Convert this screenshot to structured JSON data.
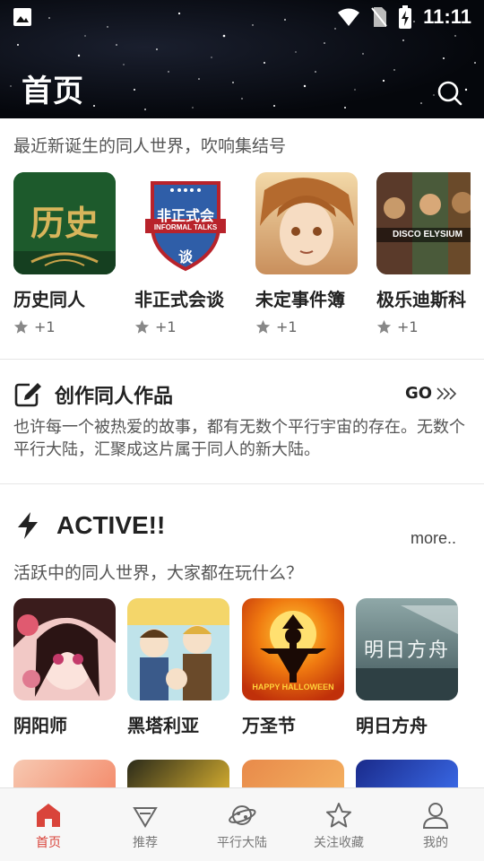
{
  "status_bar": {
    "time": "11:11",
    "icons": [
      "image-icon",
      "wifi-icon",
      "no-sim-icon",
      "battery-charging-icon"
    ]
  },
  "header": {
    "title": "首页",
    "search_icon": "search-icon"
  },
  "newborn": {
    "tagline": "最近新诞生的同人世界，吹响集结号",
    "worlds": [
      {
        "name": "历史同人",
        "count": "+1",
        "thumb_text": "历史"
      },
      {
        "name": "非正式会谈",
        "count": "+1",
        "thumb_text": "非正式会谈"
      },
      {
        "name": "未定事件簿",
        "count": "+1"
      },
      {
        "name": "极乐迪斯科",
        "count": "+1",
        "thumb_text": "DISCO ELYSIUM"
      }
    ]
  },
  "create": {
    "title": "创作同人作品",
    "go_label": "GO",
    "description": "也许每一个被热爱的故事，都有无数个平行宇宙的存在。无数个平行大陆，汇聚成这片属于同人的新大陆。"
  },
  "active": {
    "title": "ACTIVE!!",
    "more_label": "more..",
    "tagline": "活跃中的同人世界，大家都在玩什么？",
    "worlds": [
      {
        "name": "阴阳师"
      },
      {
        "name": "黑塔利亚"
      },
      {
        "name": "万圣节",
        "thumb_text": "HAPPY HALLOWEEN"
      },
      {
        "name": "明日方舟",
        "thumb_text": "明日方舟"
      }
    ]
  },
  "bottom_nav": {
    "items": [
      {
        "label": "首页",
        "icon": "home-icon",
        "active": true
      },
      {
        "label": "推荐",
        "icon": "diamond-icon",
        "active": false
      },
      {
        "label": "平行大陆",
        "icon": "planet-icon",
        "active": false
      },
      {
        "label": "关注收藏",
        "icon": "star-icon",
        "active": false
      },
      {
        "label": "我的",
        "icon": "user-icon",
        "active": false
      }
    ]
  },
  "colors": {
    "accent": "#d9443b",
    "header_bg": "#05070c",
    "text_primary": "#222222",
    "text_secondary": "#555555"
  }
}
